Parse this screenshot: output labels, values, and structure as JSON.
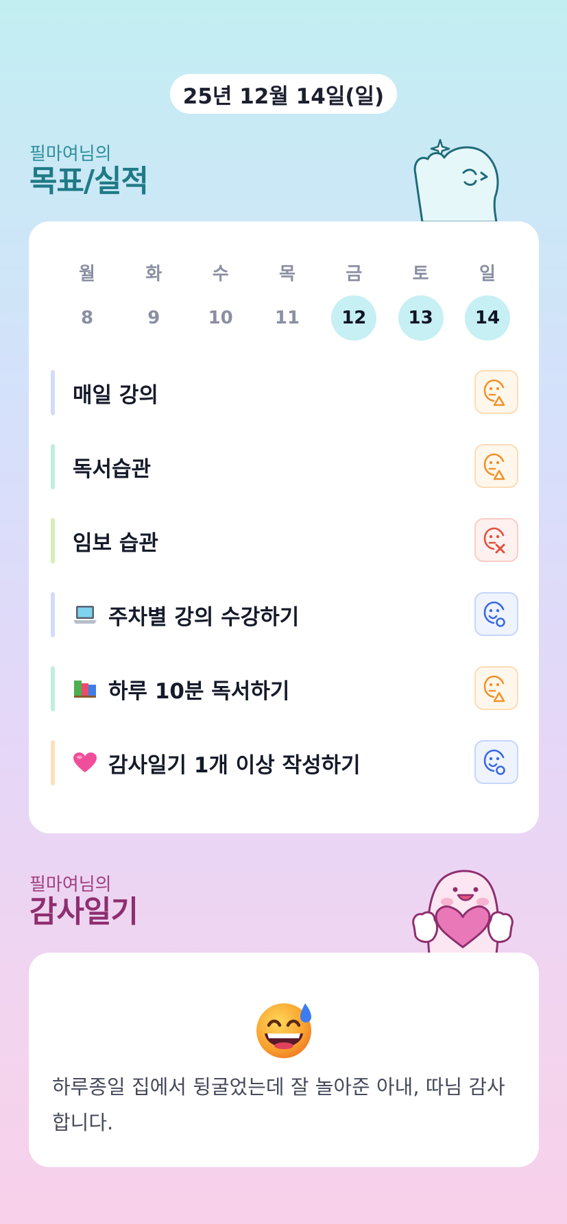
{
  "header": {
    "date": "25년 12월 14일(일)"
  },
  "goals_section": {
    "subtitle": "필마여님의",
    "title": "목표/실적"
  },
  "week": {
    "days": [
      "월",
      "화",
      "수",
      "목",
      "금",
      "토",
      "일"
    ],
    "dates": [
      "8",
      "9",
      "10",
      "11",
      "12",
      "13",
      "14"
    ],
    "active_dates": [
      "12",
      "13",
      "14"
    ]
  },
  "goals": [
    {
      "label": "매일 강의",
      "emoji": "",
      "bar_color": "#d3dcf7",
      "status": "partial"
    },
    {
      "label": "독서습관",
      "emoji": "",
      "bar_color": "#bfeedd",
      "status": "partial"
    },
    {
      "label": "임보 습관",
      "emoji": "",
      "bar_color": "#d4eeb3",
      "status": "fail"
    },
    {
      "label": "주차별 강의 수강하기",
      "emoji": "laptop-icon",
      "bar_color": "#d3dcf7",
      "status": "success"
    },
    {
      "label": "하루 10분 독서하기",
      "emoji": "books-icon",
      "bar_color": "#bfeedd",
      "status": "partial"
    },
    {
      "label": "감사일기 1개 이상 작성하기",
      "emoji": "pink-heart-icon",
      "bar_color": "#fce0b8",
      "status": "success"
    }
  ],
  "status_colors": {
    "partial": {
      "fg": "#f0922a",
      "bg": "#fff7ec",
      "border": "#fbdcb4"
    },
    "fail": {
      "fg": "#e0503e",
      "bg": "#fff1ef",
      "border": "#f8cdc6"
    },
    "success": {
      "fg": "#3a68e0",
      "bg": "#eef3fe",
      "border": "#c6d5f8"
    }
  },
  "diary_section": {
    "subtitle": "필마여님의",
    "title": "감사일기"
  },
  "diary": {
    "emoji": "grinning-face-with-sweat-icon",
    "text": "하루종일 집에서 뒹굴었는데 잘 놀아준 아내, 따님 감사합니다."
  }
}
